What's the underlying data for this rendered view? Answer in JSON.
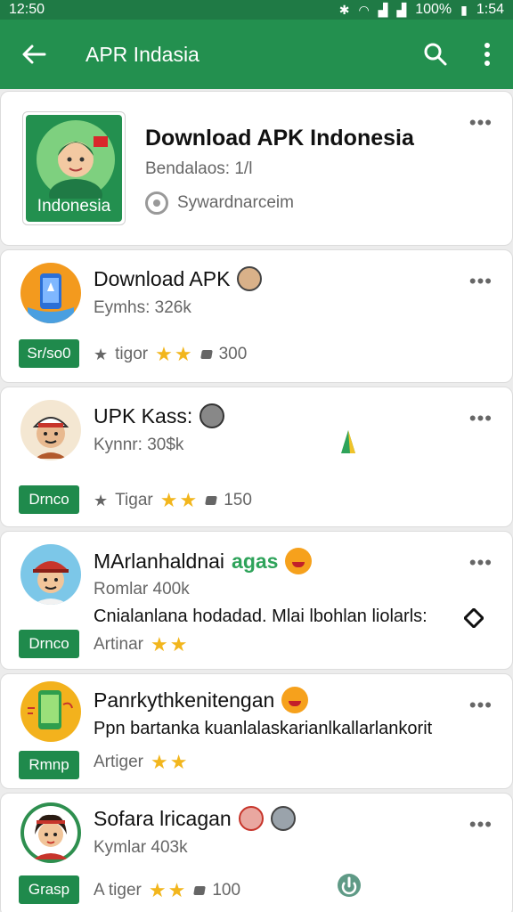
{
  "status_bar": {
    "left_time": "12:50",
    "right_text": "100%",
    "clock": "1:54"
  },
  "app_bar": {
    "title": "APR Indasia",
    "icons": [
      "back-arrow-icon",
      "search-icon",
      "more-vert-icon"
    ]
  },
  "featured": {
    "logo_caption": "Indonesia",
    "title": "Download APK Indonesia",
    "subtitle": "Bendalaos: 1/l",
    "developer": "Sywardnarceim"
  },
  "items": [
    {
      "title": "Download APK",
      "subtitle": "Eymhs: 326k",
      "tag": "Sr/so0",
      "category": "tigor",
      "stars": "★★",
      "downloads": "300"
    },
    {
      "title": "UPK Kass:",
      "subtitle": "Kynnr: 30$k",
      "tag": "Drnco",
      "category": "Tigar",
      "stars": "★★",
      "downloads": "150"
    },
    {
      "title": "MArlanhaldnai",
      "title_extra": "agas",
      "subtitle": "Romlar 400k",
      "description": "Cnialanlana hodadad. Mlai lbohlan liolarls:",
      "tag": "Drnco",
      "category": "Artinar",
      "stars": "★★"
    },
    {
      "title": "Panrkythkenitengan",
      "description": "Ppn bartanka kuanlalaskarianlkallarlankorit",
      "tag": "Rmnp",
      "category": "Artiger",
      "stars": "★★"
    },
    {
      "title": "Sofara lricagan",
      "subtitle": "Kymlar 403k",
      "tag": "Grasp",
      "category": "A tiger",
      "stars": "★★",
      "downloads": "100"
    }
  ],
  "colors": {
    "app_bar": "#23904f",
    "status_bar": "#1f7a45",
    "tag": "#1f8a4c",
    "star": "#f2b61d"
  }
}
